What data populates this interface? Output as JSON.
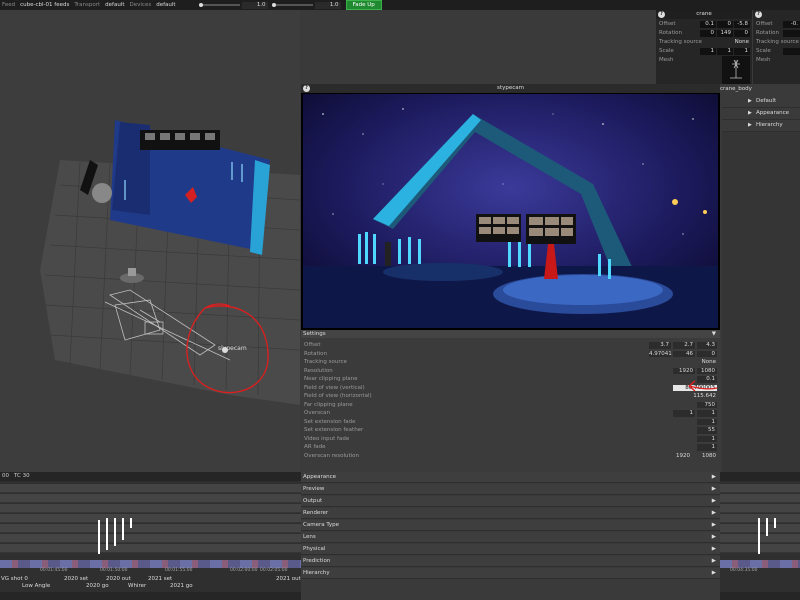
{
  "topbar": {
    "feed_label": "Feed",
    "feed_value": "cube-cbl-01 feeds",
    "transport_label": "Transport",
    "transport_value": "default",
    "devices_label": "Devices",
    "devices_value": "default",
    "volume1": "1.0",
    "volume2": "1.0",
    "fade_up": "Fade Up"
  },
  "viewport": {
    "camera_label": "slypecam"
  },
  "camera_window": {
    "title": "stypecam",
    "help": "?"
  },
  "settings": {
    "header": "Settings",
    "rows": [
      {
        "name": "Offset",
        "values": [
          "3.7",
          "2.7",
          "4.3"
        ]
      },
      {
        "name": "Rotation",
        "values": [
          "4.97041",
          "46",
          "0"
        ]
      },
      {
        "name": "Tracking source",
        "values": [
          "None"
        ]
      },
      {
        "name": "Resolution",
        "values": [
          "1920",
          "1080"
        ]
      },
      {
        "name": "Near clipping plane",
        "values": [
          "0.1"
        ]
      },
      {
        "name": "Field of view (vertical)",
        "values": [
          "86.700003"
        ]
      },
      {
        "name": "Field of view (horizontal)",
        "values": [
          "115.642"
        ]
      },
      {
        "name": "Far clipping plane",
        "values": [
          "750"
        ]
      },
      {
        "name": "Overscan",
        "values": [
          "1",
          "1"
        ]
      },
      {
        "name": "Set extension fade",
        "values": [
          "1"
        ]
      },
      {
        "name": "Set extension feather",
        "values": [
          "55"
        ]
      },
      {
        "name": "Video input fade",
        "values": [
          "1"
        ]
      },
      {
        "name": "AR fade",
        "values": [
          "1"
        ]
      },
      {
        "name": "Overscan resolution",
        "values": [
          "1920",
          "1080"
        ]
      }
    ]
  },
  "sections": [
    {
      "label": "Appearance"
    },
    {
      "label": "Preview"
    },
    {
      "label": "Output"
    },
    {
      "label": "Renderer"
    },
    {
      "label": "Camera Type"
    },
    {
      "label": "Lens"
    },
    {
      "label": "Physical"
    },
    {
      "label": "Prediction"
    },
    {
      "label": "Hierarchy"
    }
  ],
  "timeline": {
    "header_left": "00",
    "header_tc": "TC 30",
    "bottom_labels": [
      {
        "text": "VG shot 0"
      },
      {
        "text": "Low Angle"
      },
      {
        "text": "2020 set"
      },
      {
        "text": "2020 go"
      },
      {
        "text": "2020 out"
      },
      {
        "text": "Whirer"
      },
      {
        "text": "2021 set"
      },
      {
        "text": "2021 go"
      },
      {
        "text": "2021 out"
      }
    ],
    "ruler": [
      "00:01:45:00",
      "00:01:50:00",
      "00:01:55:00",
      "00:02:00:00",
      "00:02:05:00",
      "00:02:10:00",
      "00:04:35:00"
    ]
  },
  "crane_panel": {
    "title": "crane",
    "rows": [
      {
        "name": "Offset",
        "values": [
          "0.1",
          "0",
          "-5.8"
        ]
      },
      {
        "name": "Rotation",
        "values": [
          "0",
          "149",
          "0"
        ]
      },
      {
        "name": "Tracking source",
        "values": [
          "None"
        ]
      },
      {
        "name": "Scale",
        "values": [
          "1",
          "1",
          "1"
        ]
      },
      {
        "name": "Mesh",
        "values": []
      }
    ],
    "mesh_name": "crane_body"
  },
  "right_panel": {
    "rows": [
      {
        "name": "Offset",
        "values": [
          "-0."
        ]
      },
      {
        "name": "Rotation",
        "values": [
          ""
        ]
      },
      {
        "name": "Tracking source",
        "values": [
          ""
        ]
      },
      {
        "name": "Scale",
        "values": [
          ""
        ]
      },
      {
        "name": "Mesh",
        "values": []
      }
    ],
    "sections": [
      {
        "label": "Default"
      },
      {
        "label": "Appearance"
      },
      {
        "label": "Hierarchy"
      }
    ]
  }
}
